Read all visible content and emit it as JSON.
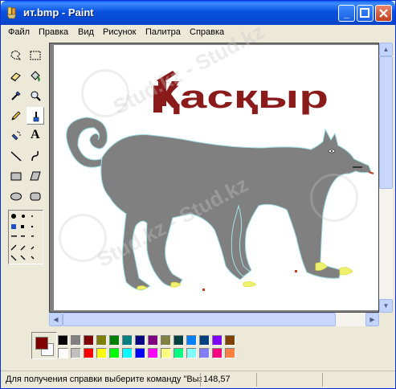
{
  "window": {
    "title": "ит.bmp - Paint",
    "app_icon": "paint-icon",
    "controls": [
      "minimize-icon",
      "maximize-icon",
      "close-icon"
    ]
  },
  "menu": {
    "items": [
      "Файл",
      "Правка",
      "Вид",
      "Рисунок",
      "Палитра",
      "Справка"
    ]
  },
  "toolbox": {
    "tools": [
      {
        "name": "free-select-icon"
      },
      {
        "name": "rect-select-icon"
      },
      {
        "name": "eraser-icon"
      },
      {
        "name": "fill-icon"
      },
      {
        "name": "pick-color-icon"
      },
      {
        "name": "magnifier-icon"
      },
      {
        "name": "pencil-icon"
      },
      {
        "name": "brush-icon",
        "selected": true
      },
      {
        "name": "airbrush-icon"
      },
      {
        "name": "text-icon",
        "glyph": "A"
      },
      {
        "name": "line-icon"
      },
      {
        "name": "curve-icon"
      },
      {
        "name": "rectangle-icon"
      },
      {
        "name": "polygon-icon"
      },
      {
        "name": "ellipse-icon"
      },
      {
        "name": "rounded-rect-icon"
      }
    ]
  },
  "canvas": {
    "title_text": "Қасқыр",
    "title_color": "#8b1a1a",
    "wolf_color": "#808080"
  },
  "palette": {
    "foreground": "#800000",
    "background": "#ffffff",
    "row1": [
      "#000000",
      "#808080",
      "#800000",
      "#808000",
      "#008000",
      "#008080",
      "#000080",
      "#800080",
      "#808040",
      "#004040",
      "#0080ff",
      "#004080",
      "#8000ff",
      "#804000"
    ],
    "row2": [
      "#ffffff",
      "#c0c0c0",
      "#ff0000",
      "#ffff00",
      "#00ff00",
      "#00ffff",
      "#0000ff",
      "#ff00ff",
      "#ffff80",
      "#00ff80",
      "#80ffff",
      "#8080ff",
      "#ff0080",
      "#ff8040"
    ]
  },
  "status": {
    "help_text": "Для получения справки выберите команду \"Вызов",
    "coords": "148,57"
  },
  "watermark": {
    "text": "Stud.kz - Stud.kz"
  }
}
